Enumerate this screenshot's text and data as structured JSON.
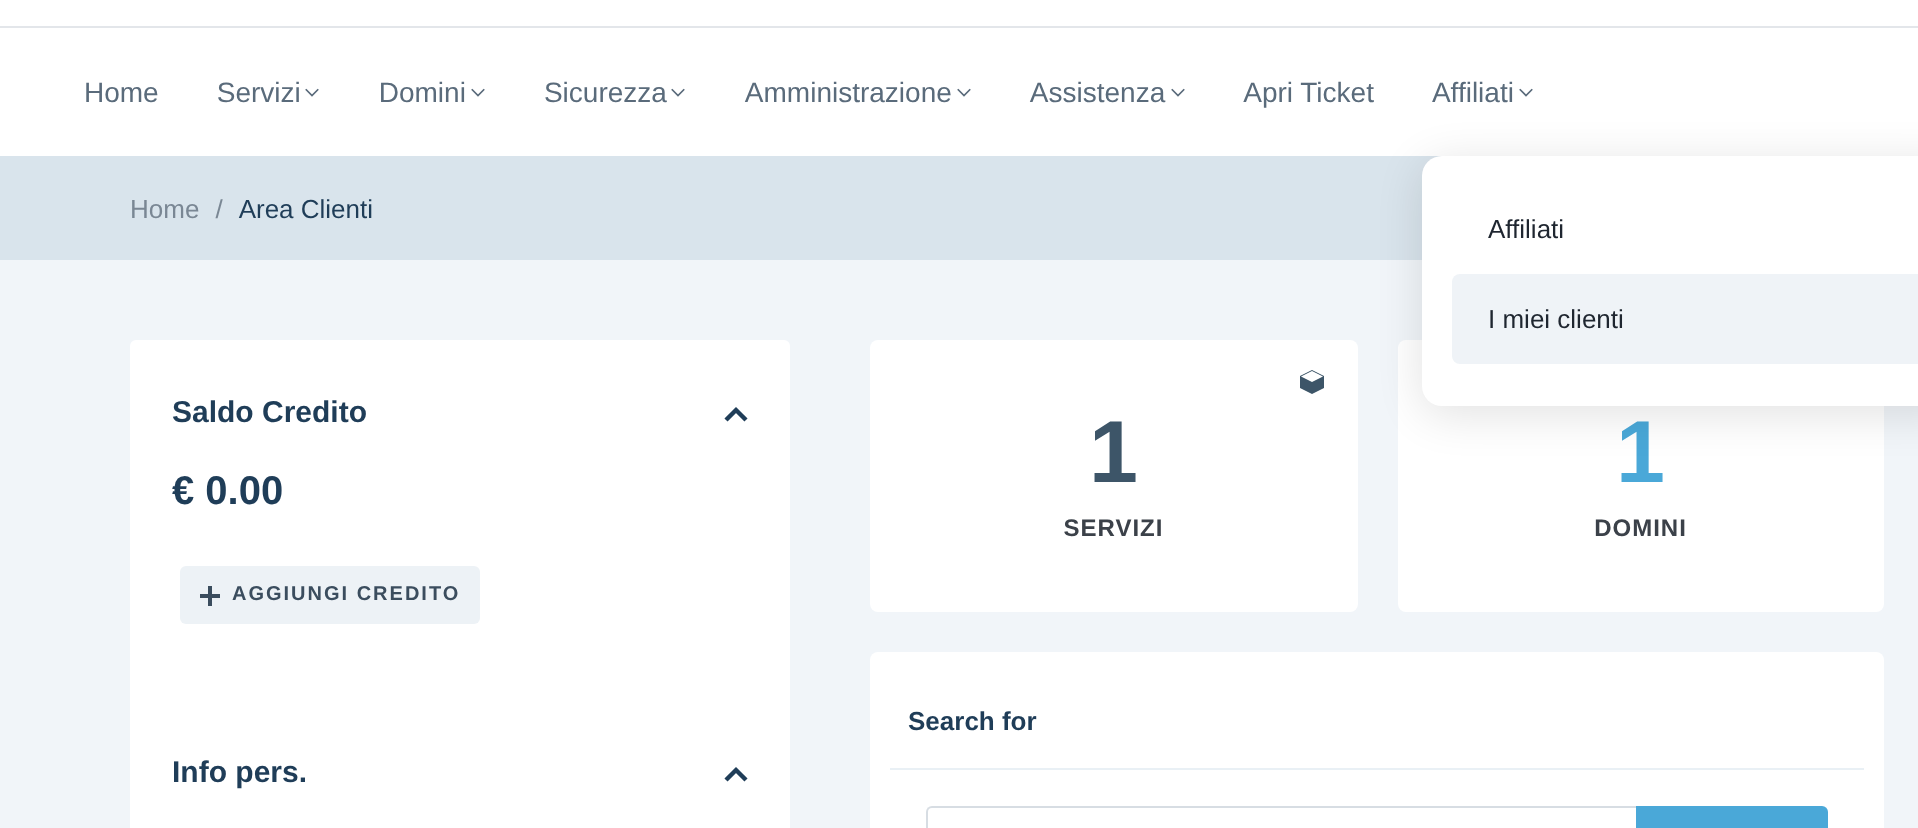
{
  "nav": [
    {
      "label": "Home",
      "has_menu": false
    },
    {
      "label": "Servizi",
      "has_menu": true
    },
    {
      "label": "Domini",
      "has_menu": true
    },
    {
      "label": "Sicurezza",
      "has_menu": true
    },
    {
      "label": "Amministrazione",
      "has_menu": true
    },
    {
      "label": "Assistenza",
      "has_menu": true
    },
    {
      "label": "Apri Ticket",
      "has_menu": false
    },
    {
      "label": "Affiliati",
      "has_menu": true
    }
  ],
  "breadcrumb": [
    "Home",
    "Area Clienti"
  ],
  "breadcrumb_separator": "/",
  "dropdown": [
    {
      "label": "Affiliati",
      "selected": false
    },
    {
      "label": "I miei clienti",
      "selected": true
    }
  ],
  "sidebar": [
    {
      "title": "Saldo Credito",
      "expanded": true,
      "amount": "€ 0.00",
      "button": "AGGIUNGI CREDITO"
    },
    {
      "title": "Info pers.",
      "expanded": true
    }
  ],
  "stats": [
    {
      "value": "1",
      "label": "SERVIZI",
      "color": "#3d5568",
      "has_icon": true
    },
    {
      "value": "1",
      "label": "DOMINI",
      "color": "#4aa8d8"
    }
  ],
  "search": {
    "title": "Search for"
  }
}
